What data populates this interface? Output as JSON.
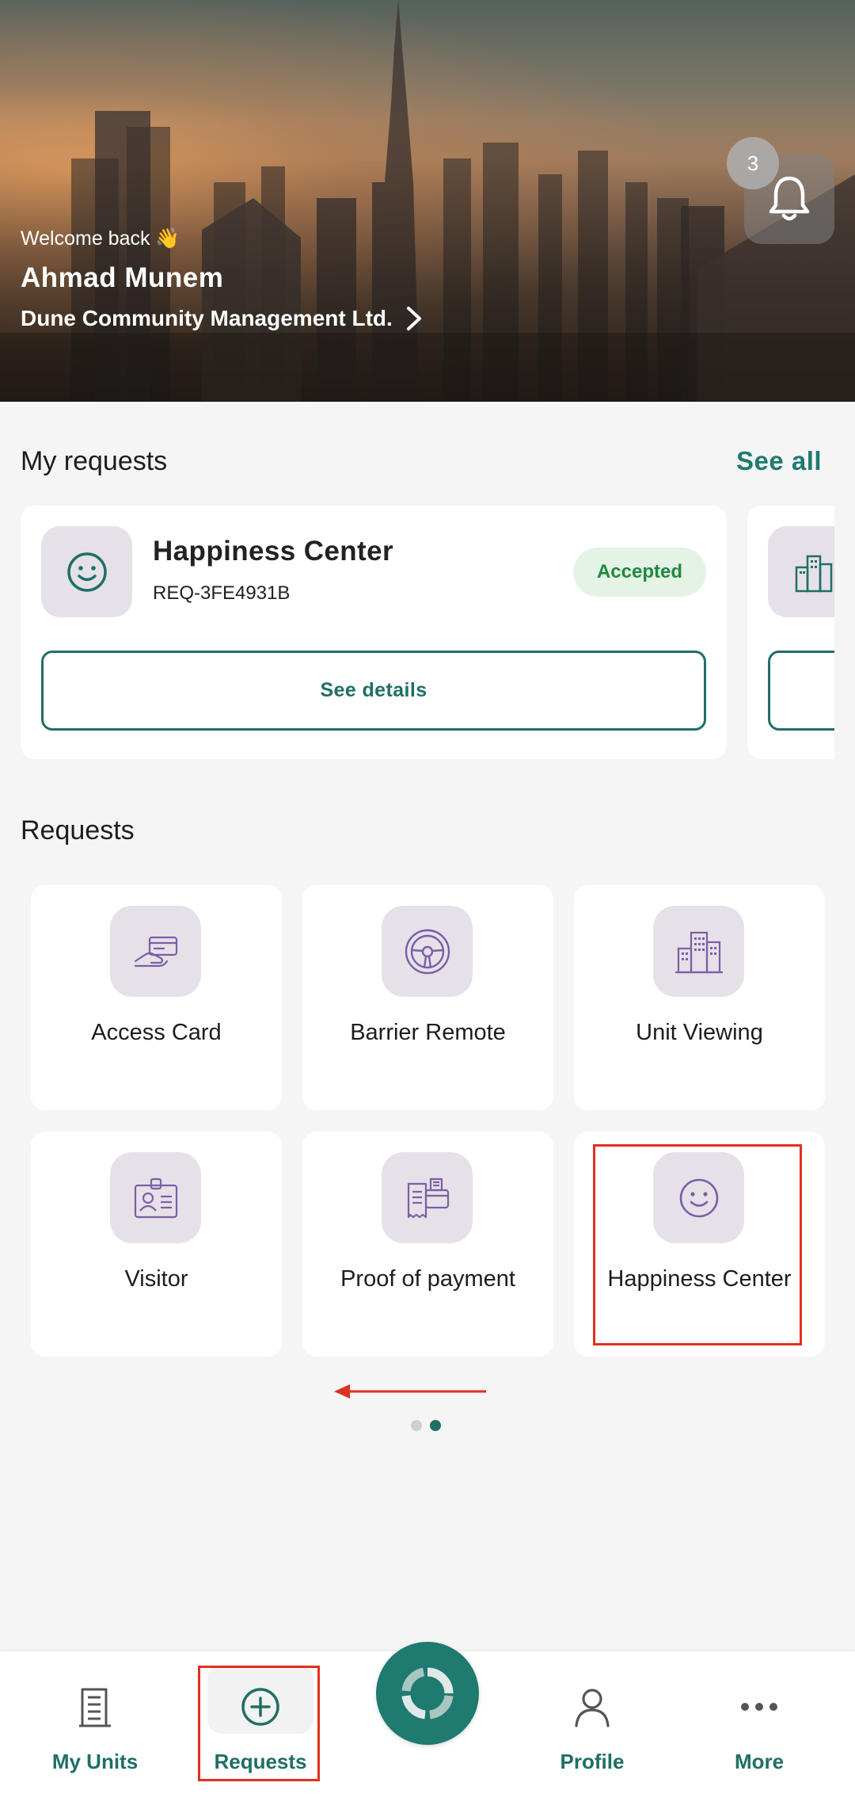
{
  "hero": {
    "welcome": "Welcome back 👋",
    "user_name": "Ahmad Munem",
    "company": "Dune Community Management Ltd.",
    "notification_count": "3"
  },
  "my_requests": {
    "title": "My requests",
    "see_all": "See all",
    "cards": [
      {
        "icon": "smiley-icon",
        "title": "Happiness Center",
        "request_id": "REQ-3FE4931B",
        "status": "Accepted",
        "button": "See details"
      },
      {
        "icon": "building-icon"
      }
    ]
  },
  "requests": {
    "title": "Requests",
    "items": [
      {
        "label": "Access Card",
        "icon": "access-card-icon"
      },
      {
        "label": "Barrier Remote",
        "icon": "steering-wheel-icon"
      },
      {
        "label": "Unit Viewing",
        "icon": "building-icon"
      },
      {
        "label": "Visitor",
        "icon": "id-badge-icon"
      },
      {
        "label": "Proof of payment",
        "icon": "receipt-card-icon"
      },
      {
        "label": "Happiness Center",
        "icon": "smiley-icon"
      }
    ],
    "page_count": 2,
    "current_page": 2
  },
  "bottom_nav": {
    "items": [
      {
        "label": "My Units",
        "icon": "building-icon"
      },
      {
        "label": "Requests",
        "icon": "plus-circle-icon"
      },
      {
        "label": "",
        "icon": "app-logo-icon"
      },
      {
        "label": "Profile",
        "icon": "user-icon"
      },
      {
        "label": "More",
        "icon": "more-dots-icon"
      }
    ]
  },
  "colors": {
    "accent": "#1f7a70",
    "icon_purple": "#7b5ea7",
    "icon_bg": "#e6e1e8",
    "status_green": "#1e8a3e",
    "status_bg": "#e4f3e6",
    "annotation_red": "#e0301e"
  }
}
